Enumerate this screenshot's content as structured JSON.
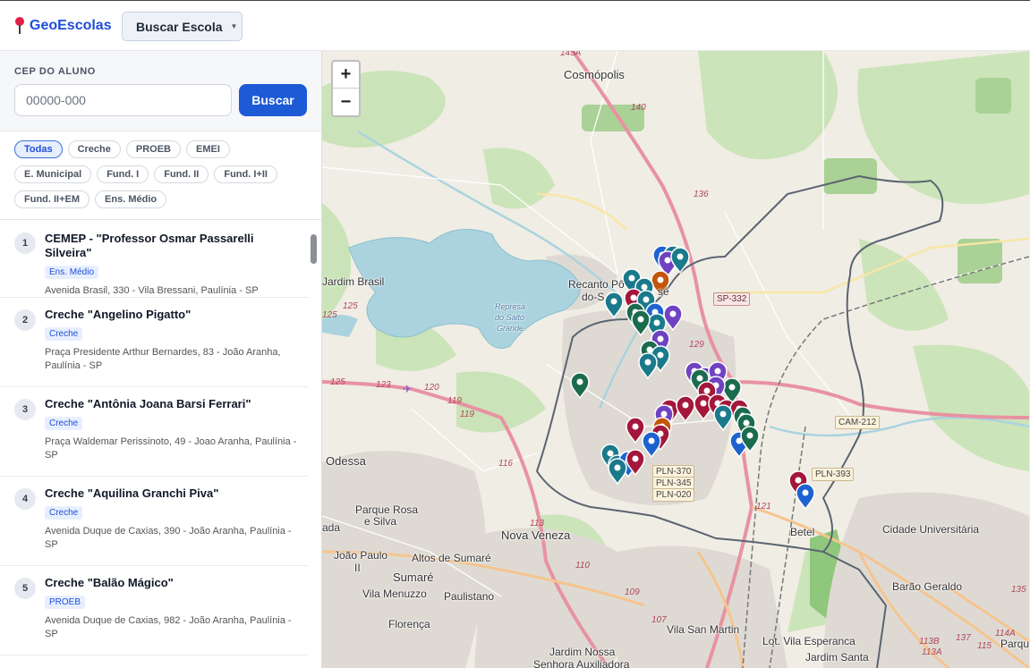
{
  "header": {
    "brand": "GeoEscolas",
    "search_school_label": "Buscar Escola"
  },
  "cep": {
    "label": "CEP DO ALUNO",
    "placeholder": "00000-000",
    "value": "",
    "button": "Buscar"
  },
  "filters": [
    {
      "label": "Todas",
      "active": true
    },
    {
      "label": "Creche",
      "active": false
    },
    {
      "label": "PROEB",
      "active": false
    },
    {
      "label": "EMEI",
      "active": false
    },
    {
      "label": "E. Municipal",
      "active": false
    },
    {
      "label": "Fund. I",
      "active": false
    },
    {
      "label": "Fund. II",
      "active": false
    },
    {
      "label": "Fund. I+II",
      "active": false
    },
    {
      "label": "Fund. II+EM",
      "active": false
    },
    {
      "label": "Ens. Médio",
      "active": false
    }
  ],
  "schools": [
    {
      "n": "1",
      "name": "CEMEP - \"Professor Osmar Passarelli Silveira\"",
      "type": "Ens. Médio",
      "address": "Avenida Brasil, 330 - Vila Bressani, Paulínia - SP"
    },
    {
      "n": "2",
      "name": "Creche \"Angelino Pigatto\"",
      "type": "Creche",
      "address": "Praça Presidente Arthur Bernardes, 83 - João Aranha, Paulínia - SP"
    },
    {
      "n": "3",
      "name": "Creche \"Antônia Joana Barsi Ferrari\"",
      "type": "Creche",
      "address": "Praça Waldemar Perissinoto, 49 - Joao Aranha, Paulínia - SP"
    },
    {
      "n": "4",
      "name": "Creche \"Aquilina Granchi Piva\"",
      "type": "Creche",
      "address": "Avenida Duque de Caxias, 390 - João Aranha, Paulínia - SP"
    },
    {
      "n": "5",
      "name": "Creche \"Balão Mágico\"",
      "type": "PROEB",
      "address": "Avenida Duque de Caxias, 982 - João Aranha, Paulínia - SP"
    }
  ],
  "map": {
    "zoom_in": "+",
    "zoom_out": "−",
    "places": [
      {
        "text": "Cosmópolis",
        "big": true
      },
      {
        "text": "Recanto Pô",
        "big": false
      },
      {
        "text": "do-S",
        "big": false
      },
      {
        "text": "sé",
        "big": false
      },
      {
        "text": "Jardim Brasil",
        "big": false
      },
      {
        "text": "Represa",
        "big": false
      },
      {
        "text": "do Salto",
        "big": false
      },
      {
        "text": "Grande",
        "big": false
      },
      {
        "text": "Odessa",
        "big": true
      },
      {
        "text": "Parque Rosa",
        "big": false
      },
      {
        "text": "e Silva",
        "big": false
      },
      {
        "text": "ada",
        "big": false
      },
      {
        "text": "Nova Veneza",
        "big": true
      },
      {
        "text": "João Paulo",
        "big": false
      },
      {
        "text": "II",
        "big": false
      },
      {
        "text": "Altos de Sumaré",
        "big": false
      },
      {
        "text": "Sumaré",
        "big": true
      },
      {
        "text": "Vila Menuzzo",
        "big": false
      },
      {
        "text": "Paulistano",
        "big": false
      },
      {
        "text": "Florença",
        "big": false
      },
      {
        "text": "Jardim Nossa",
        "big": false
      },
      {
        "text": "Senhora Auxiliadora",
        "big": false
      },
      {
        "text": "Vila San Martin",
        "big": false
      },
      {
        "text": "Lot. Vila Esperanca",
        "big": false
      },
      {
        "text": "Jardim Santa",
        "big": false
      },
      {
        "text": "Betel",
        "big": false
      },
      {
        "text": "Cidade Universitária",
        "big": false
      },
      {
        "text": "Barão Geraldo",
        "big": false
      },
      {
        "text": "Parqu",
        "big": false
      }
    ],
    "shields": [
      "SP-332",
      "CAM-212",
      "PLN-393",
      "PLN-370",
      "PLN-345",
      "PLN-020"
    ],
    "road_numbers": [
      "145A",
      "140",
      "136",
      "125",
      "125",
      "125",
      "123",
      "120",
      "119",
      "119",
      "116",
      "113",
      "110",
      "109",
      "107",
      "121",
      "129",
      "137",
      "113B",
      "113A",
      "114A",
      "115",
      "135"
    ],
    "marker_colors": {
      "teal": "#1a7a8c",
      "green": "#1b6b4e",
      "purple": "#6f42c1",
      "crimson": "#a3183a",
      "blue": "#1e62d0",
      "orange": "#c4560b",
      "red": "#b3202c"
    }
  }
}
